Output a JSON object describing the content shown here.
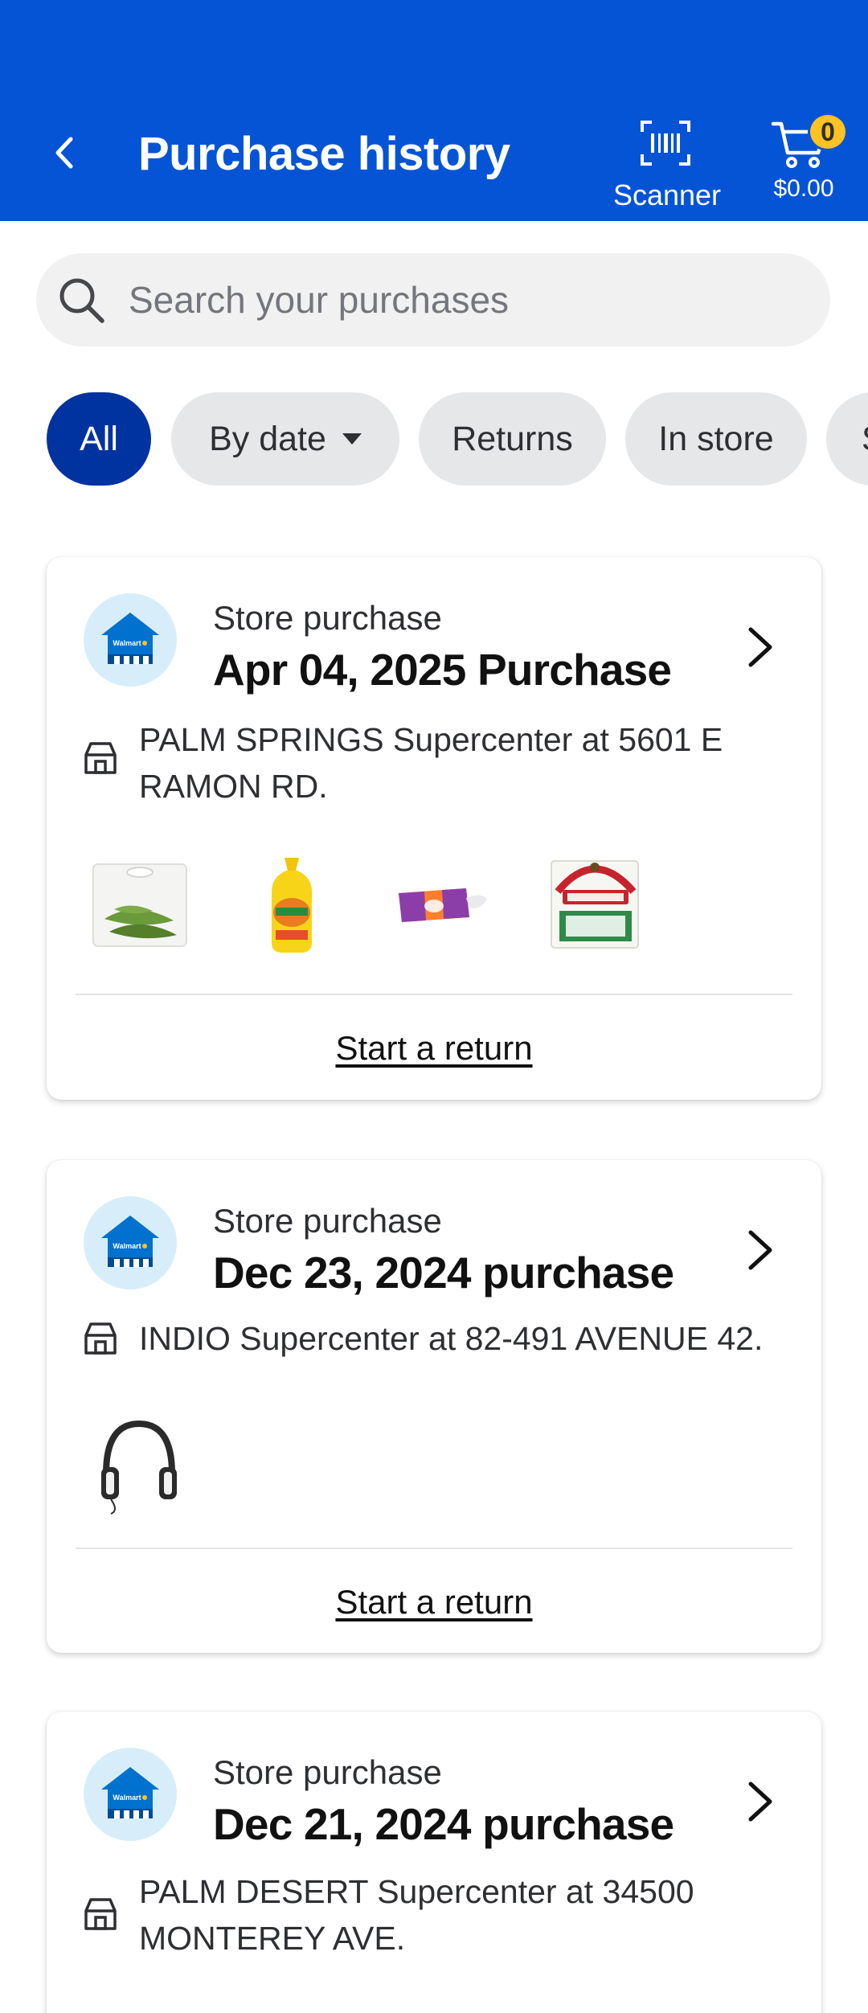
{
  "header": {
    "title": "Purchase history",
    "scanner_label": "Scanner",
    "cart_count": "0",
    "cart_total": "$0.00",
    "bg_color": "#0654d6"
  },
  "search": {
    "placeholder": "Search your purchases"
  },
  "filters": [
    {
      "label": "All",
      "active": true
    },
    {
      "label": "By date",
      "has_caret": true
    },
    {
      "label": "Returns"
    },
    {
      "label": "In store"
    },
    {
      "label": "S"
    }
  ],
  "purchases": [
    {
      "type": "Store purchase",
      "title": "Apr 04, 2025 Purchase",
      "address": "PALM SPRINGS Supercenter at 5601 E RAMON RD.",
      "products": [
        "jalapeno-peppers",
        "corn-tortillas",
        "carrots-bag",
        "casero-cheese"
      ],
      "return_label": "Start a return"
    },
    {
      "type": "Store purchase",
      "title": "Dec 23, 2024 purchase",
      "address": "INDIO Supercenter at 82-491 AVENUE 42.",
      "products": [
        "headphones"
      ],
      "return_label": "Start a return"
    },
    {
      "type": "Store purchase",
      "title": "Dec 21, 2024 purchase",
      "address": "PALM DESERT Supercenter at 34500 MONTEREY AVE."
    }
  ],
  "logo_text": "Walmart",
  "colors": {
    "accent": "#0654d6",
    "active_chip": "#0033a0",
    "badge": "#ffc220"
  }
}
